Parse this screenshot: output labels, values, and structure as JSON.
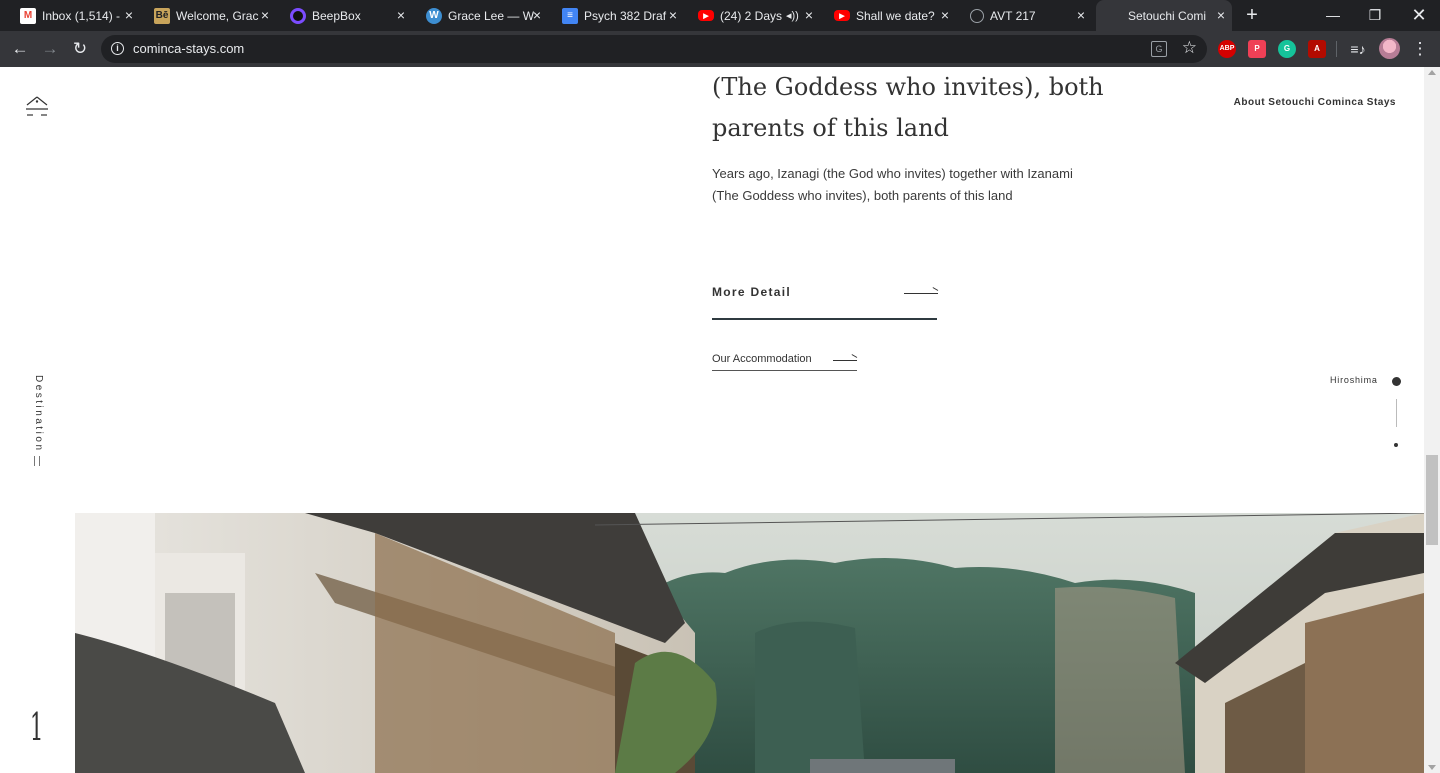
{
  "browser": {
    "tabs": [
      {
        "title": "Inbox (1,514) -",
        "icon": "gmail-icon",
        "icon_color": "#ea4335"
      },
      {
        "title": "Welcome, Grac",
        "icon": "behance-icon",
        "icon_color": "#c8a45b"
      },
      {
        "title": "BeepBox",
        "icon": "beepbox-icon",
        "icon_color": "#7b4cff"
      },
      {
        "title": "Grace Lee — W",
        "icon": "wordpress-icon",
        "icon_color": "#3d8ed1"
      },
      {
        "title": "Psych 382 Draf",
        "icon": "google-docs-icon",
        "icon_color": "#4285f4"
      },
      {
        "title": "(24) 2 Days",
        "icon": "youtube-icon",
        "icon_color": "#ff0000"
      },
      {
        "title": "Shall we date?",
        "icon": "youtube-icon",
        "icon_color": "#ff0000"
      },
      {
        "title": "AVT 217",
        "icon": "globe-icon",
        "icon_color": "#9aa0a6"
      },
      {
        "title": "Setouchi Comi",
        "icon": "none",
        "icon_color": "#9aa0a6"
      }
    ],
    "url": "cominca-stays.com",
    "extensions": [
      {
        "name": "adblock-plus-icon",
        "label": "ABP",
        "color": "#d50000"
      },
      {
        "name": "pocket-icon",
        "label": "P",
        "color": "#ef4056"
      },
      {
        "name": "grammarly-icon",
        "label": "G",
        "color": "#15c39a"
      },
      {
        "name": "acrobat-icon",
        "label": "A",
        "color": "#b30b00"
      }
    ]
  },
  "page": {
    "heading": "(The Goddess who invites), both parents of this land",
    "paragraph": "Years ago, Izanagi (the God who invites) together with Izanami (The Goddess who invites), both parents of this land",
    "more_detail": "More Detail",
    "our_accommodation": "Our Accommodation",
    "nav_about": "About Setouchi Cominca Stays",
    "side_label": "Destination",
    "side_number": "1",
    "location": "Hiroshima"
  },
  "colors": {
    "text": "#333333",
    "underline": "#2f3a40",
    "chrome_dark": "#202124",
    "chrome_toolbar": "#35363a"
  }
}
